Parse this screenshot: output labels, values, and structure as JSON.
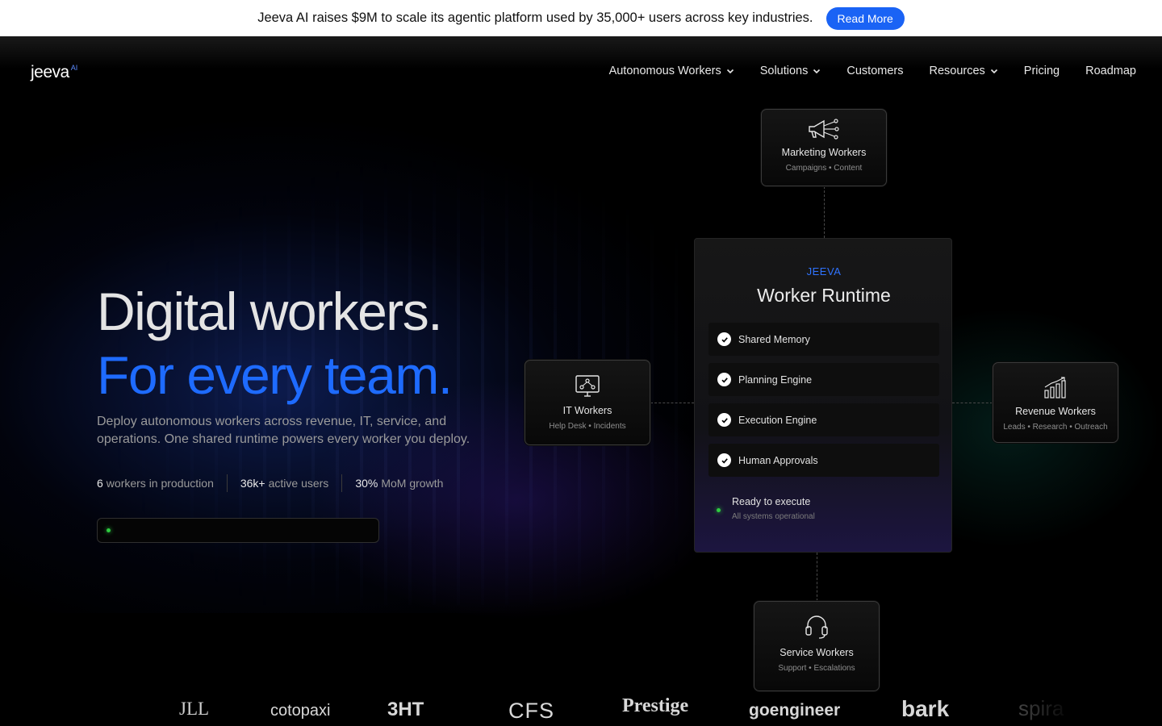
{
  "announcement": {
    "text": "Jeeva AI raises $9M to scale its agentic platform used by 35,000+ users across key industries.",
    "button_label": "Read More"
  },
  "brand": {
    "word": "jeeva",
    "suffix": "AI"
  },
  "nav": {
    "items": [
      {
        "label": "Autonomous Workers",
        "dropdown": true
      },
      {
        "label": "Solutions",
        "dropdown": true
      },
      {
        "label": "Customers",
        "dropdown": false
      },
      {
        "label": "Resources",
        "dropdown": true
      },
      {
        "label": "Pricing",
        "dropdown": false
      },
      {
        "label": "Roadmap",
        "dropdown": false
      }
    ]
  },
  "hero": {
    "title_line1": "Digital workers.",
    "title_line2": "For every team.",
    "subtitle": "Deploy autonomous workers across revenue, IT, service, and operations. One shared runtime powers every worker you deploy.",
    "stats": [
      {
        "value": "6",
        "label": "workers in production"
      },
      {
        "value": "36k+",
        "label": "active users"
      },
      {
        "value": "30%",
        "label": "MoM growth"
      }
    ]
  },
  "runtime": {
    "label": "JEEVA",
    "title": "Worker Runtime",
    "items": [
      "Shared Memory",
      "Planning Engine",
      "Execution Engine",
      "Human Approvals"
    ],
    "status_title": "Ready to execute",
    "status_sub": "All systems operational"
  },
  "workers": {
    "marketing": {
      "title": "Marketing Workers",
      "sub": "Campaigns • Content",
      "icon": "megaphone-icon"
    },
    "it": {
      "title": "IT Workers",
      "sub": "Help Desk • Incidents",
      "icon": "monitor-network-icon"
    },
    "revenue": {
      "title": "Revenue Workers",
      "sub": "Leads • Research • Outreach",
      "icon": "bar-chart-icon"
    },
    "service": {
      "title": "Service Workers",
      "sub": "Support • Escalations",
      "icon": "headset-icon"
    }
  },
  "customer_logos": [
    "JLL",
    "cotopaxi",
    "3HT",
    "CFS",
    "Prestige",
    "goengineer",
    "bark",
    "spira"
  ],
  "colors": {
    "accent": "#1e6bff",
    "announce_button": "#1a63f5",
    "status_green": "#2ecc40"
  }
}
